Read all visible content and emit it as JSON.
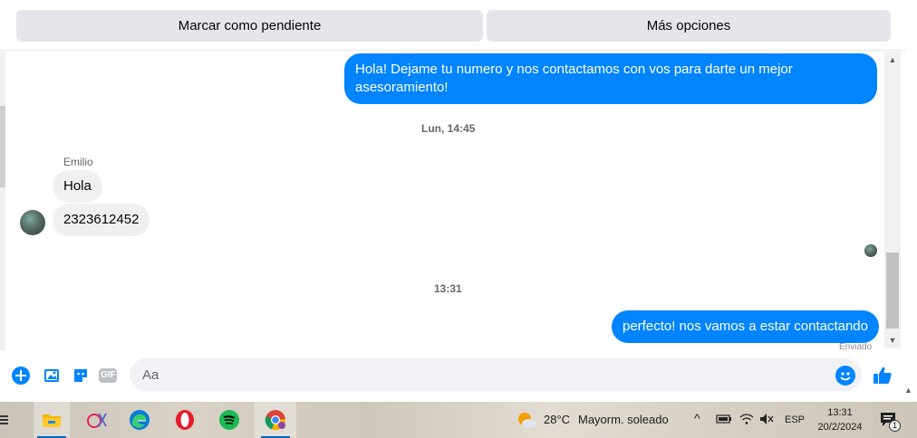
{
  "actions": {
    "mark_pending": "Marcar como pendiente",
    "more_options": "Más opciones"
  },
  "chat": {
    "outgoing_1": "Hola! Dejame tu numero y nos contactamos con vos para darte un mejor asesoramiento!",
    "separator_1": "Lun, 14:45",
    "sender_name": "Emilio",
    "incoming_1": "Hola",
    "incoming_2": "2323612452",
    "separator_2": "13:31",
    "outgoing_2": "perfecto! nos vamos a estar contactando",
    "seen_label": "Enviado"
  },
  "composer": {
    "placeholder": "Aa",
    "icons": [
      "plus-circle-icon",
      "photo-icon",
      "sticker-icon",
      "gif-icon",
      "emoji-icon",
      "thumbs-up-icon"
    ],
    "gif_label": "GIF",
    "accent": "#0084ff"
  },
  "taskbar": {
    "apps": [
      "task-view-icon",
      "file-explorer-icon",
      "snipping-tool-icon",
      "edge-icon",
      "opera-icon",
      "spotify-icon",
      "chrome-icon"
    ],
    "weather_temp": "28°C",
    "weather_desc": "Mayorm. soleado",
    "language": "ESP",
    "time": "13:31",
    "date": "20/2/2024",
    "notification_count": "1"
  }
}
